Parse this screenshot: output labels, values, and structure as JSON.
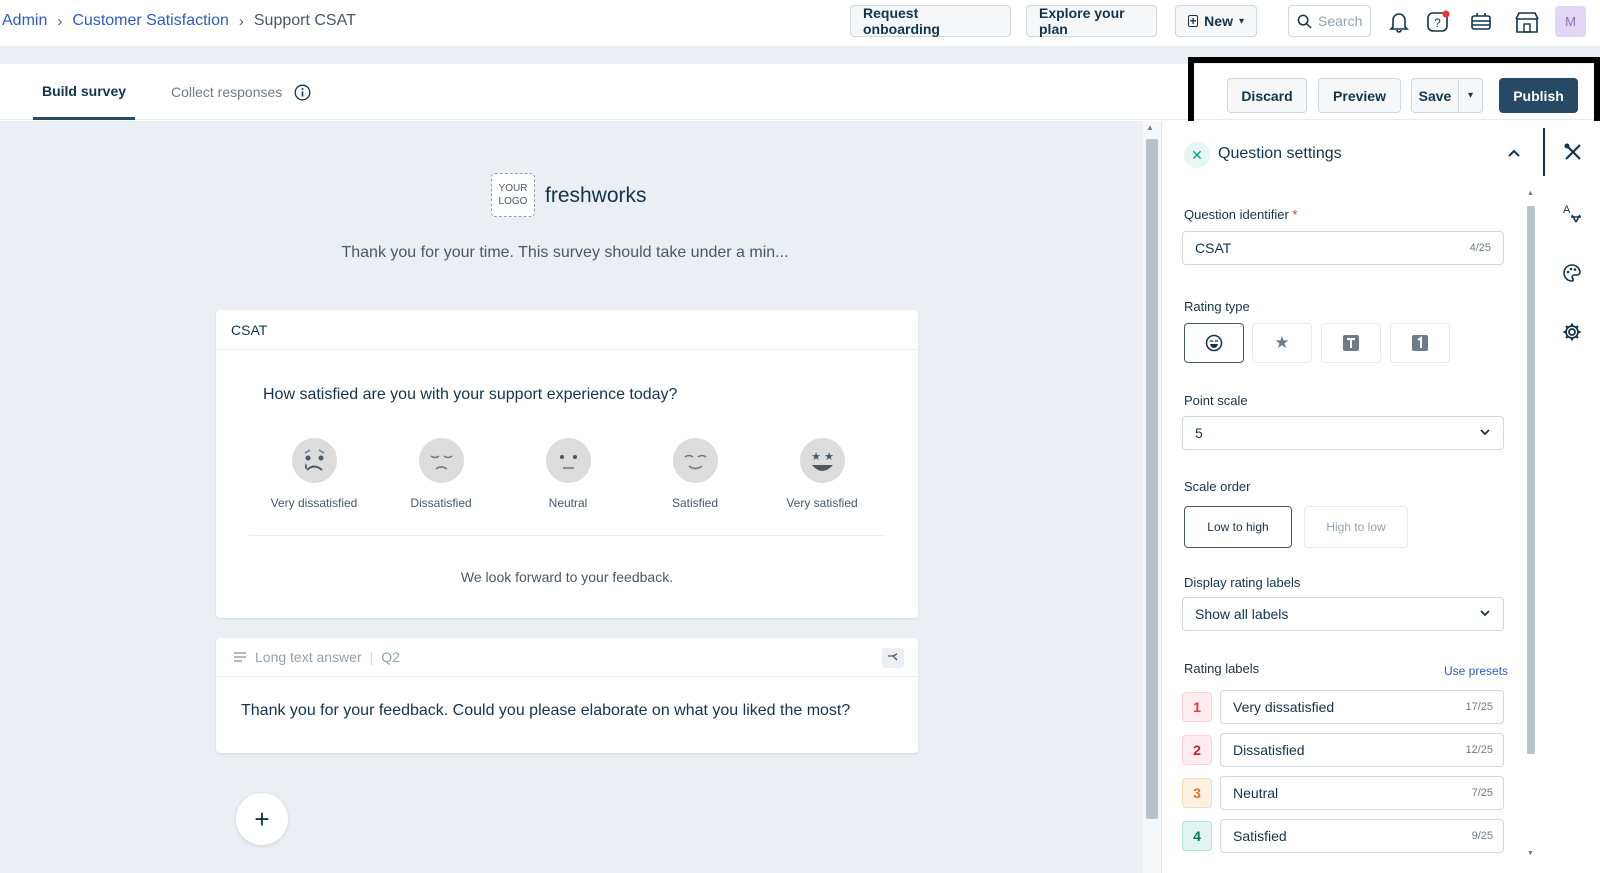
{
  "breadcrumb": {
    "root": "Admin",
    "parent": "Customer Satisfaction",
    "current": "Support CSAT"
  },
  "header": {
    "request_onboarding": "Request onboarding",
    "explore_plan": "Explore your plan",
    "new_label": "New",
    "search_placeholder": "Search",
    "avatar_initial": "M"
  },
  "tabs": {
    "build": "Build survey",
    "collect": "Collect responses"
  },
  "actions": {
    "discard": "Discard",
    "preview": "Preview",
    "save": "Save",
    "publish": "Publish"
  },
  "survey": {
    "logo_text": "YOUR LOGO",
    "brand": "freshworks",
    "intro": "Thank you for your time. This survey should take under a min...",
    "q1": {
      "identifier": "CSAT",
      "question": "How satisfied are you with your support experience today?",
      "options": [
        "Very dissatisfied",
        "Dissatisfied",
        "Neutral",
        "Satisfied",
        "Very satisfied"
      ],
      "footer": "We look forward to your feedback."
    },
    "q2": {
      "type": "Long text answer",
      "id": "Q2",
      "question": "Thank you for your feedback. Could you please elaborate on what you liked the most?"
    },
    "add_label": "+"
  },
  "settings": {
    "title": "Question settings",
    "identifier_label": "Question identifier",
    "identifier_value": "CSAT",
    "identifier_count": "4/25",
    "rating_type_label": "Rating type",
    "point_scale_label": "Point scale",
    "point_scale_value": "5",
    "scale_order_label": "Scale order",
    "scale_low_high": "Low to high",
    "scale_high_low": "High to low",
    "display_labels_label": "Display rating labels",
    "display_labels_value": "Show all labels",
    "rating_labels_label": "Rating labels",
    "use_presets": "Use presets",
    "rating_labels": [
      {
        "num": "1",
        "text": "Very dissatisfied",
        "count": "17/25"
      },
      {
        "num": "2",
        "text": "Dissatisfied",
        "count": "12/25"
      },
      {
        "num": "3",
        "text": "Neutral",
        "count": "7/25"
      },
      {
        "num": "4",
        "text": "Satisfied",
        "count": "9/25"
      }
    ]
  },
  "colors": {
    "accent": "#264966",
    "link": "#2c5cc5",
    "canvas": "#ebeff3"
  },
  "icons": [
    "search-icon",
    "bell-icon",
    "help-icon",
    "announcement-icon",
    "store-icon",
    "info-icon",
    "settings-tools-icon",
    "translate-icon",
    "palette-icon",
    "gear-icon"
  ]
}
